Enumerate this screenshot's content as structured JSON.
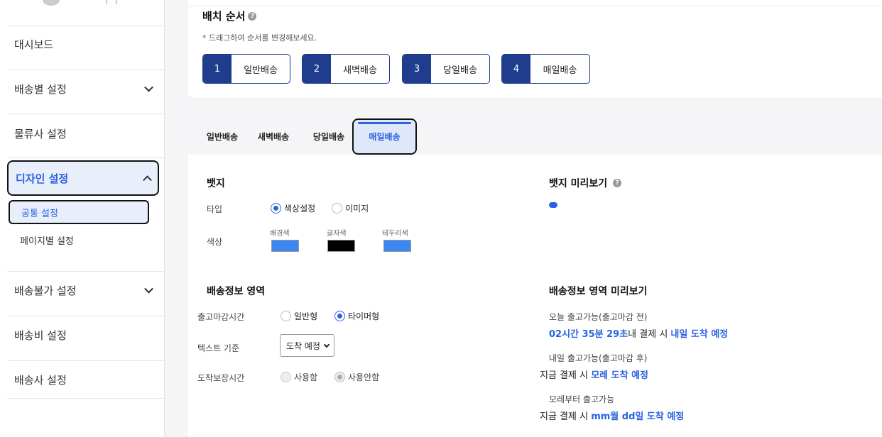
{
  "sidebar": {
    "items": [
      {
        "label": "대시보드"
      },
      {
        "label": "배송별 설정"
      },
      {
        "label": "물류사 설정"
      },
      {
        "label": "디자인 설정"
      },
      {
        "label": "배송불가 설정"
      },
      {
        "label": "배송비 설정"
      },
      {
        "label": "배송사 설정"
      }
    ],
    "subitems": [
      {
        "label": "공통 설정"
      },
      {
        "label": "페이지별 설정"
      }
    ]
  },
  "order": {
    "title": "배치 순서",
    "hint": "* 드래그하여 순서를 변경해보세요.",
    "buttons": [
      {
        "num": "1",
        "label": "일반배송"
      },
      {
        "num": "2",
        "label": "새벽배송"
      },
      {
        "num": "3",
        "label": "당일배송"
      },
      {
        "num": "4",
        "label": "매일배송"
      }
    ]
  },
  "tabs": [
    {
      "label": "일반배송"
    },
    {
      "label": "새벽배송"
    },
    {
      "label": "당일배송"
    },
    {
      "label": "매일배송"
    }
  ],
  "badge": {
    "title": "뱃지",
    "type_label": "타입",
    "type_options": [
      "색상설정",
      "이미지"
    ],
    "color_label": "색상",
    "swatches": [
      {
        "label": "배경색",
        "color": "#3b86f0"
      },
      {
        "label": "글자색",
        "color": "#000000"
      },
      {
        "label": "테두리색",
        "color": "#3b86f0"
      }
    ],
    "preview_title": "뱃지 미리보기"
  },
  "delivery": {
    "title": "배송정보 영역",
    "cutoff_label": "출고마감시간",
    "cutoff_options": [
      "일반형",
      "타이머형"
    ],
    "text_basis_label": "텍스트 기준",
    "text_basis_value": "도착 예정",
    "guarantee_label": "도착보장시간",
    "guarantee_options": [
      "사용함",
      "사용안함"
    ],
    "preview_title": "배송정보 영역 미리보기",
    "previews": [
      {
        "label": "오늘 출고가능(출고마감 전)",
        "part1": "02시간 35분 29초",
        "part2": "내 결제 시 ",
        "part3": "내일 도착 예정"
      },
      {
        "label": "내일 출고가능(출고마감 후)",
        "part1": "",
        "part2": "지금 결제 시 ",
        "part3": "모레 도착 예정"
      },
      {
        "label": "모레부터 출고가능",
        "part1": "",
        "part2": "지금 결제 시 ",
        "part3": "mm월 dd일 도착 예정"
      }
    ]
  },
  "colors": {
    "accent": "#2a62e0",
    "navy": "#1f3d8c"
  }
}
